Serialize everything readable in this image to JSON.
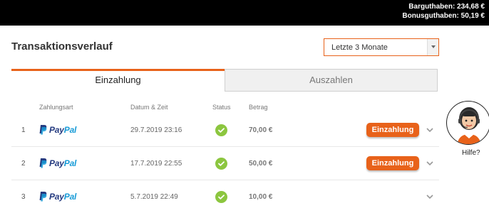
{
  "header": {
    "cash_balance": "Barguthaben: 234,68 €",
    "bonus_balance": "Bonusguthaben: 50,19 €"
  },
  "page": {
    "title": "Transaktionsverlauf",
    "period_select": {
      "value": "Letzte 3 Monate",
      "icon": "chevron-down-icon"
    }
  },
  "tabs": [
    {
      "label": "Einzahlung",
      "active": true
    },
    {
      "label": "Auszahlen",
      "active": false
    }
  ],
  "table": {
    "headers": {
      "method": "Zahlungsart",
      "datetime": "Datum & Zeit",
      "status": "Status",
      "amount": "Betrag"
    },
    "rows": [
      {
        "index": "1",
        "method": {
          "pay": "Pay",
          "pal": "Pal"
        },
        "datetime": "29.7.2019 23:16",
        "status": "check-icon",
        "amount": "70,00 €",
        "action": "Einzahlung"
      },
      {
        "index": "2",
        "method": {
          "pay": "Pay",
          "pal": "Pal"
        },
        "datetime": "17.7.2019 22:55",
        "status": "check-icon",
        "amount": "50,00 €",
        "action": "Einzahlung"
      },
      {
        "index": "3",
        "method": {
          "pay": "Pay",
          "pal": "Pal"
        },
        "datetime": "5.7.2019 22:49",
        "status": "check-icon",
        "amount": "10,00 €",
        "action": ""
      }
    ]
  },
  "help": {
    "label": "Hilfe?",
    "icon": "support-agent-icon"
  },
  "colors": {
    "accent": "#e8621a",
    "success": "#8cc63f",
    "paypal_dark": "#253b80",
    "paypal_light": "#179bd7",
    "topbar": "#000000"
  }
}
